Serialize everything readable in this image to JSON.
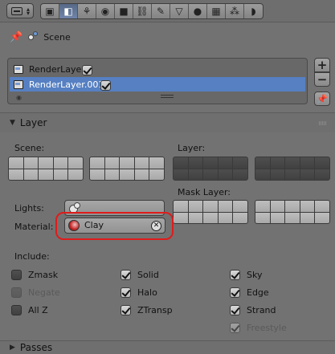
{
  "header": {
    "editor_menu_icon": "properties-editor-icon",
    "tabs": [
      {
        "icon": "render-icon",
        "glyph": "▣",
        "active": false
      },
      {
        "icon": "render-layers-icon",
        "glyph": "◧",
        "active": true
      },
      {
        "icon": "scene-icon",
        "glyph": "⚘",
        "active": false
      },
      {
        "icon": "world-icon",
        "glyph": "◉",
        "active": false
      },
      {
        "icon": "object-icon",
        "glyph": "■",
        "active": false
      },
      {
        "icon": "constraints-icon",
        "glyph": "⛓",
        "active": false
      },
      {
        "icon": "modifiers-icon",
        "glyph": "✎",
        "active": false
      },
      {
        "icon": "data-icon",
        "glyph": "▽",
        "active": false
      },
      {
        "icon": "material-icon",
        "glyph": "●",
        "active": false
      },
      {
        "icon": "texture-icon",
        "glyph": "▦",
        "active": false
      },
      {
        "icon": "particles-icon",
        "glyph": "⁂",
        "active": false
      },
      {
        "icon": "physics-icon",
        "glyph": "◗",
        "active": false
      }
    ]
  },
  "breadcrumb": {
    "pin_icon": "pin-icon",
    "icon": "scene-icon",
    "label": "Scene"
  },
  "render_layers": {
    "items": [
      {
        "label": "RenderLayer",
        "enabled": true,
        "selected": false
      },
      {
        "label": "RenderLayer.001",
        "enabled": true,
        "selected": true
      }
    ],
    "add_label": "+",
    "remove_label": "−"
  },
  "layer_panel": {
    "title": "Layer",
    "scene_label": "Scene:",
    "layer_label": "Layer:",
    "mask_layer_label": "Mask Layer:",
    "lights_label": "Lights:",
    "lights_value": "",
    "material_label": "Material:",
    "material_value": "Clay",
    "include_label": "Include:",
    "include": [
      {
        "label": "Zmask",
        "checked": false,
        "enabled": true
      },
      {
        "label": "Negate",
        "checked": false,
        "enabled": false
      },
      {
        "label": "All Z",
        "checked": false,
        "enabled": true
      },
      {
        "label": "Solid",
        "checked": true,
        "enabled": true
      },
      {
        "label": "Halo",
        "checked": true,
        "enabled": true
      },
      {
        "label": "ZTransp",
        "checked": true,
        "enabled": true
      },
      {
        "label": "Sky",
        "checked": true,
        "enabled": true
      },
      {
        "label": "Edge",
        "checked": true,
        "enabled": true
      },
      {
        "label": "Strand",
        "checked": true,
        "enabled": true
      },
      {
        "label": "Freestyle",
        "checked": true,
        "enabled": false
      }
    ]
  },
  "passes_panel": {
    "title": "Passes"
  },
  "colors": {
    "background": "#727272",
    "selection": "#5680c2",
    "highlight_ring": "#e01b1b"
  }
}
